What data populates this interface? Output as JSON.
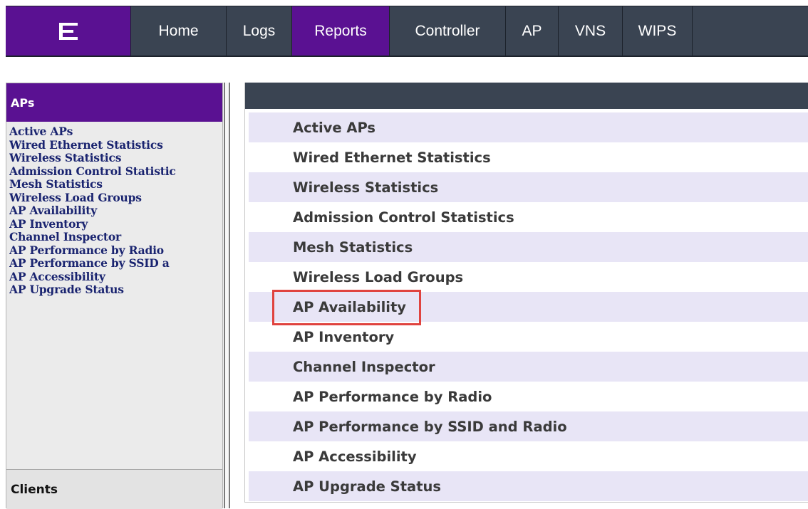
{
  "nav": {
    "tabs": [
      {
        "label": "Home"
      },
      {
        "label": "Logs"
      },
      {
        "label": "Reports",
        "active": true
      },
      {
        "label": "Controller"
      },
      {
        "label": "AP"
      },
      {
        "label": "VNS"
      },
      {
        "label": "WIPS"
      }
    ]
  },
  "sidebar": {
    "header": "APs",
    "items": [
      "Active APs",
      "Wired Ethernet Statistics",
      "Wireless Statistics",
      "Admission Control Statistic",
      "Mesh Statistics",
      "Wireless Load Groups",
      "AP Availability",
      "AP Inventory",
      "Channel Inspector",
      "AP Performance by Radio",
      "AP Performance by SSID a",
      "AP Accessibility",
      "AP Upgrade Status"
    ],
    "clients_tab": "Clients"
  },
  "main": {
    "reports": [
      "Active APs",
      "Wired Ethernet Statistics",
      "Wireless Statistics",
      "Admission Control Statistics",
      "Mesh Statistics",
      "Wireless Load Groups",
      "AP Availability",
      "AP Inventory",
      "Channel Inspector",
      "AP Performance by Radio",
      "AP Performance by SSID and Radio",
      "AP Accessibility",
      "AP Upgrade Status"
    ],
    "highlighted": "AP Availability"
  },
  "colors": {
    "brand_purple": "#5a1192",
    "nav_dark": "#3a4452",
    "row_alt": "#e8e5f6",
    "highlight": "#e0433f",
    "sidebar_link": "#1a2470"
  },
  "icons": {
    "logo": "extreme-logo-icon"
  }
}
